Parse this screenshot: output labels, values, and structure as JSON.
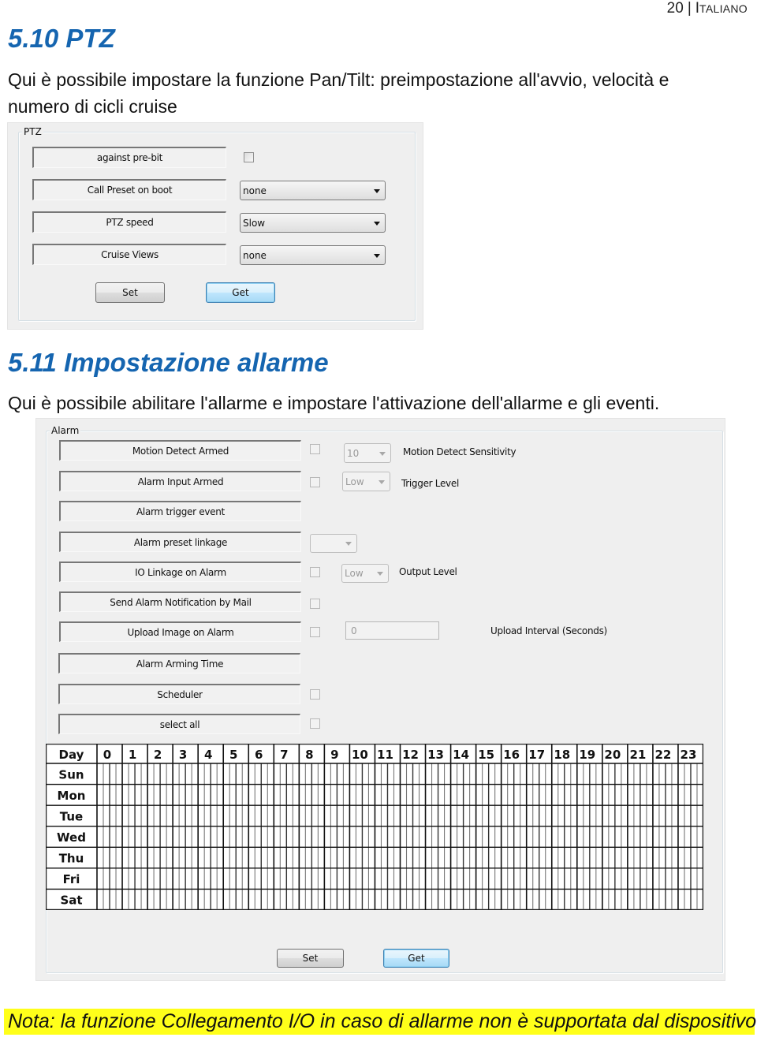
{
  "page_header": {
    "page_number": "20",
    "language_first": "I",
    "language_rest": "TALIANO"
  },
  "section_ptz": {
    "title": "5.10 PTZ",
    "description_line1": "Qui è possibile impostare la funzione Pan/Tilt: preimpostazione all'avvio, velocità e",
    "description_line2": "numero di cicli cruise",
    "dialog": {
      "group_label": "PTZ",
      "rows": [
        {
          "label": "against pre-bit",
          "control": "checkbox",
          "checked": false
        },
        {
          "label": "Call Preset on boot",
          "control": "combo",
          "value": "none"
        },
        {
          "label": "PTZ speed",
          "control": "combo",
          "value": "Slow"
        },
        {
          "label": "Cruise Views",
          "control": "combo",
          "value": "none"
        }
      ],
      "set_button": "Set",
      "get_button": "Get"
    }
  },
  "section_alarm": {
    "title": "5.11 Impostazione allarme",
    "description": "Qui è possibile abilitare l'allarme e impostare l'attivazione dell'allarme e gli eventi.",
    "dialog": {
      "group_label": "Alarm",
      "rows": [
        {
          "label": "Motion Detect Armed",
          "checked": false,
          "combo_value": "10",
          "side_label": "Motion Detect Sensitivity"
        },
        {
          "label": "Alarm Input Armed",
          "checked": false,
          "combo_value": "Low",
          "side_label": "Trigger Level"
        },
        {
          "label": "Alarm trigger event"
        },
        {
          "label": "Alarm preset linkage",
          "combo_value": ""
        },
        {
          "label": "IO Linkage on Alarm",
          "checked": false,
          "combo_value": "Low",
          "side_label": "Output Level"
        },
        {
          "label": "Send Alarm Notification by Mail",
          "checked": false
        },
        {
          "label": "Upload Image on Alarm",
          "checked": false,
          "field_value": "0",
          "side_label": "Upload Interval (Seconds)"
        },
        {
          "label": "Alarm Arming Time"
        },
        {
          "label": "Scheduler",
          "checked": false
        },
        {
          "label": "select all",
          "checked": false
        }
      ],
      "schedule": {
        "corner_label": "Day",
        "hours": [
          "0",
          "1",
          "2",
          "3",
          "4",
          "5",
          "6",
          "7",
          "8",
          "9",
          "10",
          "11",
          "12",
          "13",
          "14",
          "15",
          "16",
          "17",
          "18",
          "19",
          "20",
          "21",
          "22",
          "23"
        ],
        "days": [
          "Sun",
          "Mon",
          "Tue",
          "Wed",
          "Thu",
          "Fri",
          "Sat"
        ],
        "slots_per_hour": 4
      },
      "set_button": "Set",
      "get_button": "Get"
    }
  },
  "note": "Nota: la funzione Collegamento I/O in caso di allarme non è supportata dal dispositivo.",
  "colors": {
    "heading_blue": "#1565b0",
    "note_highlight": "#ffff1a",
    "dialog_bg": "#efefef",
    "focus_button": "#bee6fd"
  }
}
